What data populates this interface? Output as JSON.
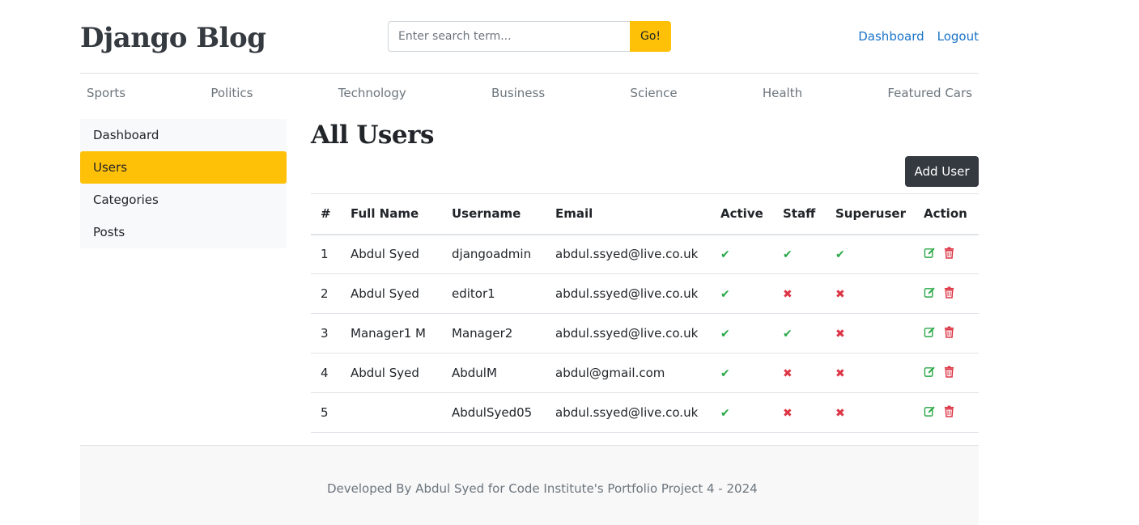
{
  "header": {
    "brand": "Django Blog",
    "search": {
      "placeholder": "Enter search term...",
      "button_label": "Go!"
    },
    "links": [
      {
        "label": "Dashboard"
      },
      {
        "label": "Logout"
      }
    ]
  },
  "category_nav": [
    {
      "label": "Sports"
    },
    {
      "label": "Politics"
    },
    {
      "label": "Technology"
    },
    {
      "label": "Business"
    },
    {
      "label": "Science"
    },
    {
      "label": "Health"
    },
    {
      "label": "Featured Cars"
    }
  ],
  "sidebar": {
    "items": [
      {
        "label": "Dashboard",
        "active": false
      },
      {
        "label": "Users",
        "active": true
      },
      {
        "label": "Categories",
        "active": false
      },
      {
        "label": "Posts",
        "active": false
      }
    ]
  },
  "main": {
    "title": "All Users",
    "add_button_label": "Add User",
    "table": {
      "columns": [
        "#",
        "Full Name",
        "Username",
        "Email",
        "Active",
        "Staff",
        "Superuser",
        "Action"
      ],
      "rows": [
        {
          "num": "1",
          "full_name": "Abdul Syed",
          "username": "djangoadmin",
          "email": "abdul.ssyed@live.co.uk",
          "active": true,
          "staff": true,
          "superuser": true
        },
        {
          "num": "2",
          "full_name": "Abdul Syed",
          "username": "editor1",
          "email": "abdul.ssyed@live.co.uk",
          "active": true,
          "staff": false,
          "superuser": false
        },
        {
          "num": "3",
          "full_name": "Manager1 M",
          "username": "Manager2",
          "email": "abdul.ssyed@live.co.uk",
          "active": true,
          "staff": true,
          "superuser": false
        },
        {
          "num": "4",
          "full_name": "Abdul Syed",
          "username": "AbdulM",
          "email": "abdul@gmail.com",
          "active": true,
          "staff": false,
          "superuser": false
        },
        {
          "num": "5",
          "full_name": "",
          "username": "AbdulSyed05",
          "email": "abdul.ssyed@live.co.uk",
          "active": true,
          "staff": false,
          "superuser": false
        }
      ]
    }
  },
  "icons": {
    "check": "check-icon",
    "cross": "cross-icon",
    "edit": "edit-icon",
    "delete": "trash-icon"
  },
  "colors": {
    "accent": "#ffc107",
    "dark": "#343a40",
    "link": "#1a73c8",
    "success": "#28a745",
    "danger": "#dc3545"
  },
  "footer": {
    "text": "Developed By Abdul Syed for Code Institute's Portfolio Project 4 - 2024"
  }
}
